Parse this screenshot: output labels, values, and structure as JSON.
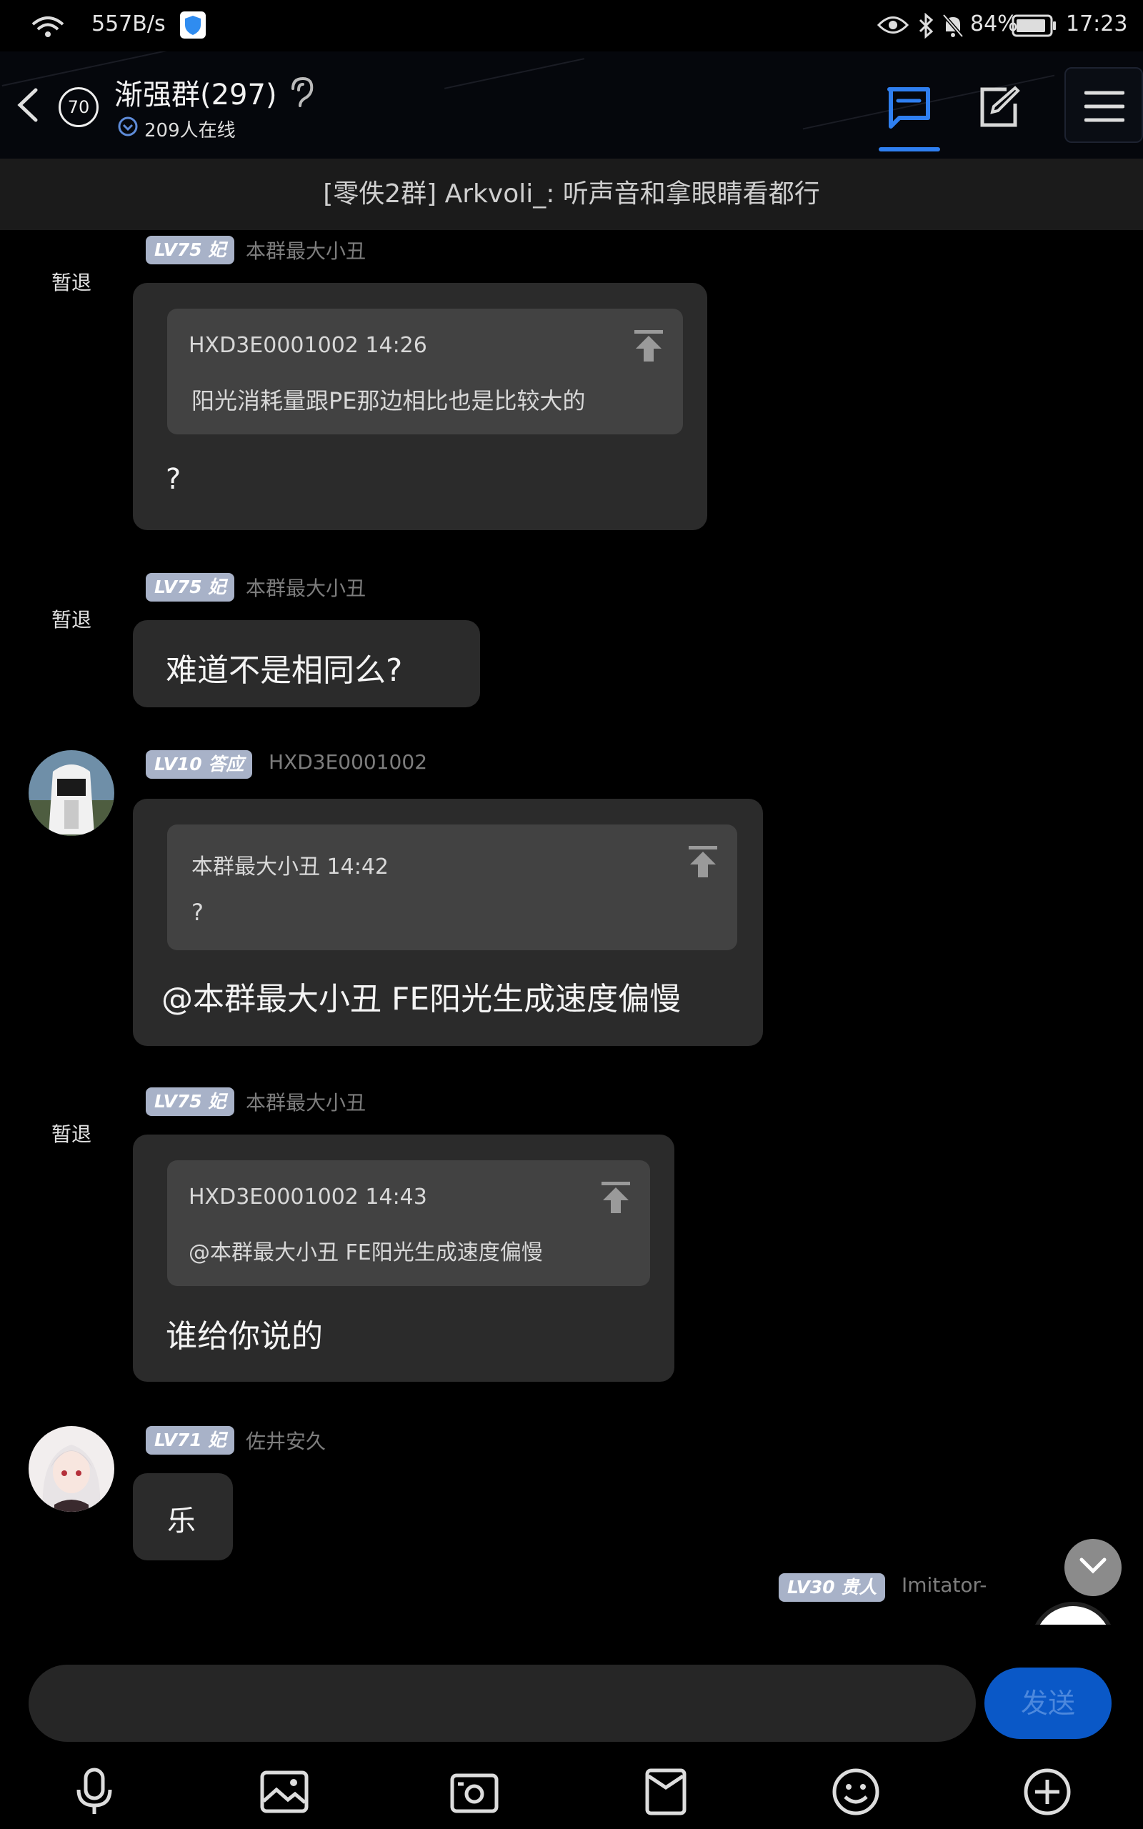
{
  "status_bar": {
    "net_speed": "557B/s",
    "battery": "84%",
    "time": "17:23"
  },
  "header": {
    "unread_count": "70",
    "title": "渐强群(297)",
    "online": "209人在线"
  },
  "announcement": "[零佚2群] Arkvoli_: 听声音和拿眼睛看都行",
  "messages": [
    {
      "badge": "LV75 妃",
      "badge_color": "#a8b2c8",
      "sender": "本群最大小丑",
      "status": "暂退",
      "quote": {
        "head": "HXD3E0001002 14:26",
        "body": "阳光消耗量跟PE那边相比也是比较大的"
      },
      "text": "?"
    },
    {
      "badge": "LV75 妃",
      "badge_color": "#a8b2c8",
      "sender": "本群最大小丑",
      "status": "暂退",
      "text": "难道不是相同么?"
    },
    {
      "badge": "LV10 答应",
      "badge_color": "#a8b2c8",
      "sender": "HXD3E0001002",
      "quote": {
        "head": "本群最大小丑 14:42",
        "body": "?"
      },
      "text": "@本群最大小丑 FE阳光生成速度偏慢"
    },
    {
      "badge": "LV75 妃",
      "badge_color": "#a8b2c8",
      "sender": "本群最大小丑",
      "status": "暂退",
      "quote": {
        "head": "HXD3E0001002 14:43",
        "body": "@本群最大小丑 FE阳光生成速度偏慢"
      },
      "text": "谁给你说的"
    },
    {
      "badge": "LV71 妃",
      "badge_color": "#a8b2c8",
      "sender": "佐井安久",
      "text": "乐"
    },
    {
      "badge": "LV30 贵人",
      "badge_color": "#a8b2c8",
      "sender": "Imitator-"
    }
  ],
  "input": {
    "placeholder": "",
    "send_label": "发送"
  },
  "colors": {
    "accent": "#2f7ff0",
    "background": "#000000",
    "bubble": "#2b2b2b",
    "quote": "#424242",
    "badge": "#a8b2c8"
  }
}
